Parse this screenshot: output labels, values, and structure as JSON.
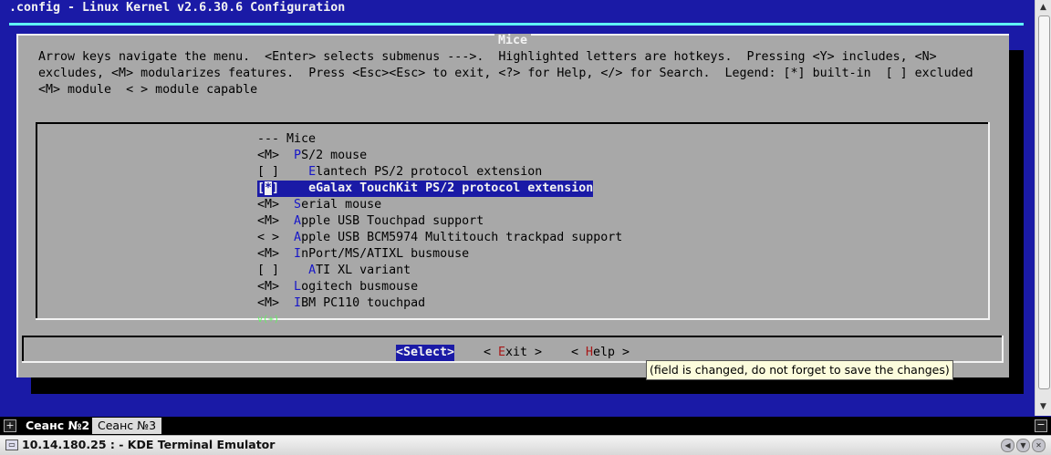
{
  "terminal": {
    "title": ".config - Linux Kernel v2.6.30.6 Configuration"
  },
  "dialog": {
    "title": "Mice",
    "help_lines": [
      "Arrow keys navigate the menu.  <Enter> selects submenus --->.  Highlighted letters are hotkeys.  Pressing <Y> includes, <N>",
      "excludes, <M> modularizes features.  Press <Esc><Esc> to exit, <?> for Help, </> for Search.  Legend: [*] built-in  [ ] excluded",
      "<M> module  < > module capable"
    ],
    "menu": {
      "header": "--- Mice",
      "items": [
        {
          "state": "<M>",
          "pre": "  ",
          "hotkey": "P",
          "rest": "S/2 mouse"
        },
        {
          "state": "[ ]",
          "pre": "    ",
          "hotkey": "E",
          "rest": "lantech PS/2 protocol extension"
        },
        {
          "state_open": "[",
          "state_mark": "*",
          "state_close": "]",
          "pre": "    ",
          "hotkey": "e",
          "rest": "Galax TouchKit PS/2 protocol extension"
        },
        {
          "state": "<M>",
          "pre": "  ",
          "hotkey": "S",
          "rest": "erial mouse"
        },
        {
          "state": "<M>",
          "pre": "  ",
          "hotkey": "A",
          "rest": "pple USB Touchpad support"
        },
        {
          "state": "< >",
          "pre": "  ",
          "hotkey": "A",
          "rest": "pple USB BCM5974 Multitouch trackpad support"
        },
        {
          "state": "<M>",
          "pre": "  ",
          "hotkey": "I",
          "rest": "nPort/MS/ATIXL busmouse"
        },
        {
          "state": "[ ]",
          "pre": "    ",
          "hotkey": "A",
          "rest": "TI XL variant"
        },
        {
          "state": "<M>",
          "pre": "  ",
          "hotkey": "L",
          "rest": "ogitech busmouse"
        },
        {
          "state": "<M>",
          "pre": "  ",
          "hotkey": "I",
          "rest": "BM PC110 touchpad"
        }
      ],
      "more_indicator": "v(+)"
    },
    "buttons": {
      "select": "<Select>",
      "exit_open": "< ",
      "exit_hotkey": "E",
      "exit_rest": "xit >",
      "help_open": "< ",
      "help_hotkey": "H",
      "help_rest": "elp >"
    }
  },
  "tooltip": "(field is changed, do not forget to save the changes)",
  "tabs": [
    {
      "label": "Сеанс №2"
    },
    {
      "label": "Сеанс №3"
    }
  ],
  "window": {
    "title": "10.14.180.25 : - KDE Terminal Emulator"
  },
  "colors": {
    "terminal_bg": "#1a1aa6",
    "dialog_bg": "#a8a8a8",
    "hotkey": "#1818c8",
    "accent": "#5ff5f5"
  }
}
